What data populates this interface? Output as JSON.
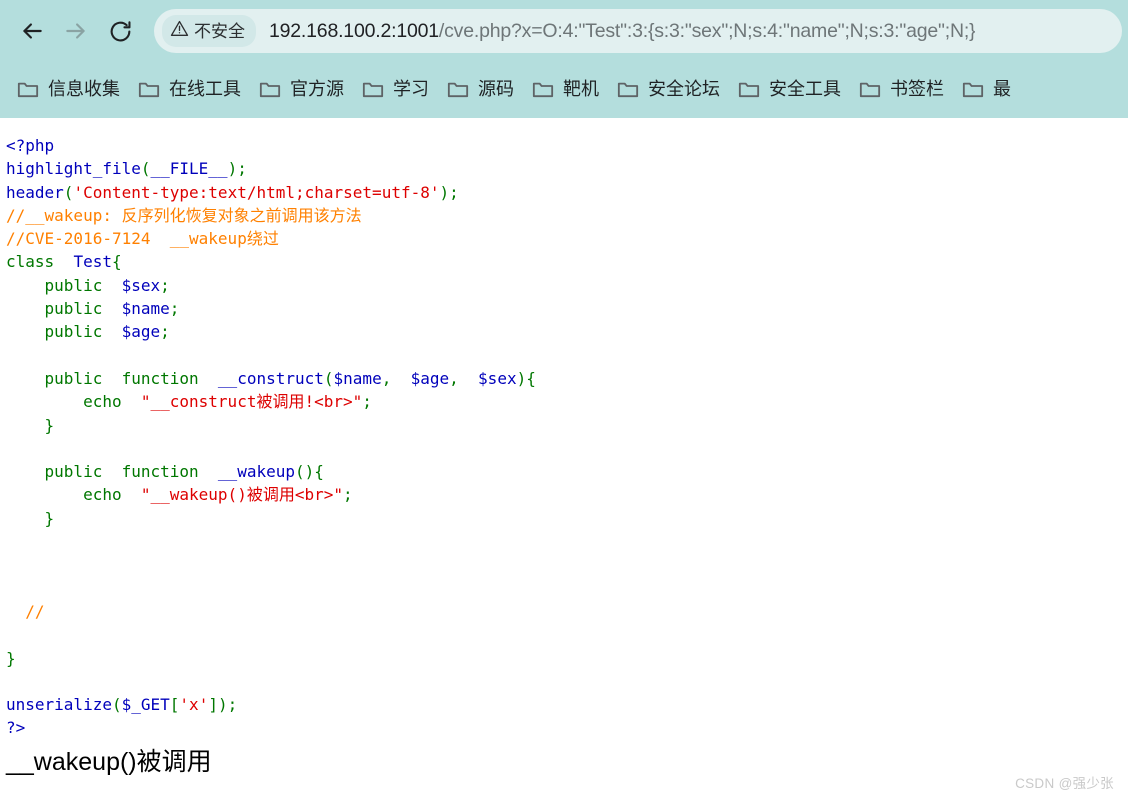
{
  "browser": {
    "nav": {
      "back_label": "Back",
      "forward_label": "Forward",
      "reload_label": "Reload"
    },
    "omnibox": {
      "security_label": "不安全",
      "security_icon": "warning-triangle-icon",
      "url_host": "192.168.100.2:1001",
      "url_path": "/cve.php?x=O:4:\"Test\":3:{s:3:\"sex\";N;s:4:\"name\";N;s:3:\"age\";N;}",
      "url_full": "192.168.100.2:1001/cve.php?x=O:4:\"Test\":3:{s:3:\"sex\";N;s:4:\"name\";N;s:3:\"age\";N;}"
    },
    "bookmarks": [
      {
        "label": "信息收集",
        "icon": "folder-icon"
      },
      {
        "label": "在线工具",
        "icon": "folder-icon"
      },
      {
        "label": "官方源",
        "icon": "folder-icon"
      },
      {
        "label": "学习",
        "icon": "folder-icon"
      },
      {
        "label": "源码",
        "icon": "folder-icon"
      },
      {
        "label": "靶机",
        "icon": "folder-icon"
      },
      {
        "label": "安全论坛",
        "icon": "folder-icon"
      },
      {
        "label": "安全工具",
        "icon": "folder-icon"
      },
      {
        "label": "书签栏",
        "icon": "folder-icon"
      },
      {
        "label": "最",
        "icon": "folder-icon"
      }
    ],
    "colors": {
      "chrome_bg": "#b4dedd",
      "omnibox_bg": "#e2f0f0",
      "chip_bg": "#d2e8e8"
    }
  },
  "page": {
    "code_lines": [
      [
        {
          "t": "<?php",
          "c": "c-default"
        }
      ],
      [
        {
          "t": "highlight_file",
          "c": "c-default"
        },
        {
          "t": "(",
          "c": "c-keyword"
        },
        {
          "t": "__FILE__",
          "c": "c-default"
        },
        {
          "t": ")",
          "c": "c-keyword"
        },
        {
          "t": ";",
          "c": "c-keyword"
        }
      ],
      [
        {
          "t": "header",
          "c": "c-default"
        },
        {
          "t": "(",
          "c": "c-keyword"
        },
        {
          "t": "'Content-type:text/html;charset=utf-8'",
          "c": "c-string"
        },
        {
          "t": ")",
          "c": "c-keyword"
        },
        {
          "t": ";",
          "c": "c-keyword"
        }
      ],
      [
        {
          "t": "//__wakeup: 反序列化恢复对象之前调用该方法",
          "c": "c-comment"
        }
      ],
      [
        {
          "t": "//CVE-2016-7124  __wakeup绕过",
          "c": "c-comment"
        }
      ],
      [
        {
          "t": "class",
          "c": "c-keyword"
        },
        {
          "t": "  ",
          "c": "c-keyword"
        },
        {
          "t": "Test",
          "c": "c-default"
        },
        {
          "t": "{",
          "c": "c-keyword"
        }
      ],
      [
        {
          "t": "    ",
          "c": "c-keyword"
        },
        {
          "t": "public",
          "c": "c-keyword"
        },
        {
          "t": "  ",
          "c": "c-keyword"
        },
        {
          "t": "$sex",
          "c": "c-default"
        },
        {
          "t": ";",
          "c": "c-keyword"
        }
      ],
      [
        {
          "t": "    ",
          "c": "c-keyword"
        },
        {
          "t": "public",
          "c": "c-keyword"
        },
        {
          "t": "  ",
          "c": "c-keyword"
        },
        {
          "t": "$name",
          "c": "c-default"
        },
        {
          "t": ";",
          "c": "c-keyword"
        }
      ],
      [
        {
          "t": "    ",
          "c": "c-keyword"
        },
        {
          "t": "public",
          "c": "c-keyword"
        },
        {
          "t": "  ",
          "c": "c-keyword"
        },
        {
          "t": "$age",
          "c": "c-default"
        },
        {
          "t": ";",
          "c": "c-keyword"
        }
      ],
      [],
      [
        {
          "t": "    ",
          "c": "c-keyword"
        },
        {
          "t": "public",
          "c": "c-keyword"
        },
        {
          "t": "  ",
          "c": "c-keyword"
        },
        {
          "t": "function",
          "c": "c-keyword"
        },
        {
          "t": "  ",
          "c": "c-keyword"
        },
        {
          "t": "__construct",
          "c": "c-default"
        },
        {
          "t": "(",
          "c": "c-keyword"
        },
        {
          "t": "$name",
          "c": "c-default"
        },
        {
          "t": ",  ",
          "c": "c-keyword"
        },
        {
          "t": "$age",
          "c": "c-default"
        },
        {
          "t": ",  ",
          "c": "c-keyword"
        },
        {
          "t": "$sex",
          "c": "c-default"
        },
        {
          "t": ")",
          "c": "c-keyword"
        },
        {
          "t": "{",
          "c": "c-keyword"
        }
      ],
      [
        {
          "t": "        ",
          "c": "c-keyword"
        },
        {
          "t": "echo",
          "c": "c-keyword"
        },
        {
          "t": "  ",
          "c": "c-keyword"
        },
        {
          "t": "\"__construct被调用!<br>\"",
          "c": "c-string"
        },
        {
          "t": ";",
          "c": "c-keyword"
        }
      ],
      [
        {
          "t": "    ",
          "c": "c-keyword"
        },
        {
          "t": "}",
          "c": "c-keyword"
        }
      ],
      [],
      [
        {
          "t": "    ",
          "c": "c-keyword"
        },
        {
          "t": "public",
          "c": "c-keyword"
        },
        {
          "t": "  ",
          "c": "c-keyword"
        },
        {
          "t": "function",
          "c": "c-keyword"
        },
        {
          "t": "  ",
          "c": "c-keyword"
        },
        {
          "t": "__wakeup",
          "c": "c-default"
        },
        {
          "t": "()",
          "c": "c-keyword"
        },
        {
          "t": "{",
          "c": "c-keyword"
        }
      ],
      [
        {
          "t": "        ",
          "c": "c-keyword"
        },
        {
          "t": "echo",
          "c": "c-keyword"
        },
        {
          "t": "  ",
          "c": "c-keyword"
        },
        {
          "t": "\"__wakeup()被调用<br>\"",
          "c": "c-string"
        },
        {
          "t": ";",
          "c": "c-keyword"
        }
      ],
      [
        {
          "t": "    ",
          "c": "c-keyword"
        },
        {
          "t": "}",
          "c": "c-keyword"
        }
      ],
      [],
      [],
      [],
      [
        {
          "t": "  ",
          "c": "c-keyword"
        },
        {
          "t": "//",
          "c": "c-comment"
        }
      ],
      [],
      [
        {
          "t": "}",
          "c": "c-keyword"
        }
      ],
      [],
      [
        {
          "t": "unserialize",
          "c": "c-default"
        },
        {
          "t": "(",
          "c": "c-keyword"
        },
        {
          "t": "$_GET",
          "c": "c-default"
        },
        {
          "t": "[",
          "c": "c-keyword"
        },
        {
          "t": "'x'",
          "c": "c-string"
        },
        {
          "t": "]",
          "c": "c-keyword"
        },
        {
          "t": ")",
          "c": "c-keyword"
        },
        {
          "t": ";",
          "c": "c-keyword"
        }
      ],
      [
        {
          "t": "?>",
          "c": "c-default"
        }
      ]
    ],
    "output": "__wakeup()被调用",
    "watermark": "CSDN @强少张"
  }
}
